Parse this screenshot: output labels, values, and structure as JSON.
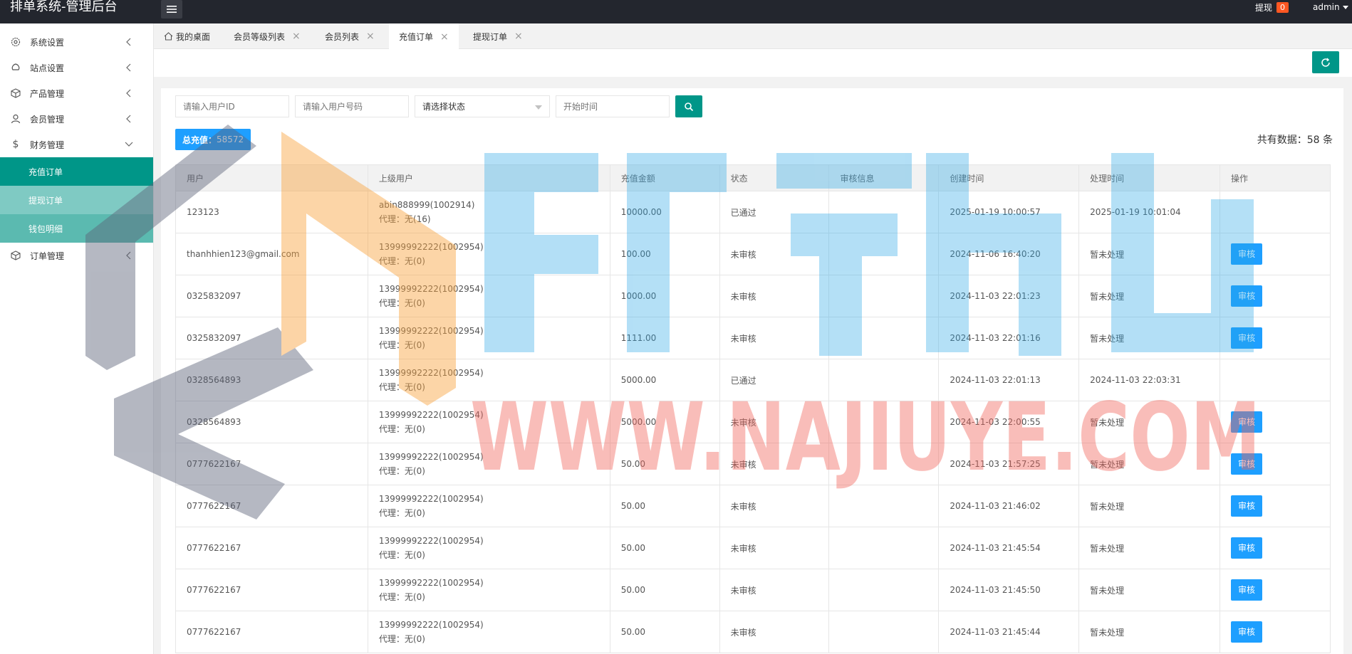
{
  "header": {
    "brand": "排单系统-管理后台",
    "withdraw_label": "提现",
    "withdraw_count": "0",
    "username": "admin"
  },
  "sidebar": {
    "items": [
      {
        "label": "系统设置",
        "icon": "gear-icon"
      },
      {
        "label": "站点设置",
        "icon": "site-icon"
      },
      {
        "label": "产品管理",
        "icon": "package-icon"
      },
      {
        "label": "会员管理",
        "icon": "user-icon"
      },
      {
        "label": "财务管理",
        "icon": "dollar-icon"
      }
    ],
    "sub_items": [
      "充值订单",
      "提现订单",
      "钱包明细"
    ],
    "after": {
      "label": "订单管理",
      "icon": "package-icon"
    }
  },
  "tabs": [
    {
      "label": "我的桌面"
    },
    {
      "label": "会员等级列表"
    },
    {
      "label": "会员列表"
    },
    {
      "label": "充值订单"
    },
    {
      "label": "提现订单"
    }
  ],
  "filters": {
    "user_id_placeholder": "请输入用户ID",
    "user_phone_placeholder": "请输入用户号码",
    "status_select": "请选择状态",
    "start_time_placeholder": "开始时间"
  },
  "summary": {
    "total_label": "总充值：",
    "total_value": "58572",
    "record_count": "共有数据：58 条"
  },
  "table": {
    "headers": [
      "用户",
      "上级用户",
      "充值金额",
      "状态",
      "审核信息",
      "创建时间",
      "处理时间",
      "操作"
    ],
    "audit_label": "审核",
    "rows": [
      {
        "user": "123123",
        "parent": "abin888999(1002914)",
        "agent": "代理：无(16)",
        "amount": "10000.00",
        "status": "已通过",
        "info": "",
        "created": "2025-01-19 10:00:57",
        "processed": "2025-01-19 10:01:04",
        "action": ""
      },
      {
        "user": "thanhhien123@gmail.com",
        "parent": "13999992222(1002954)",
        "agent": "代理：无(0)",
        "amount": "100.00",
        "status": "未审核",
        "info": "",
        "created": "2024-11-06 16:40:20",
        "processed": "暂未处理",
        "action": "审核"
      },
      {
        "user": "0325832097",
        "parent": "13999992222(1002954)",
        "agent": "代理：无(0)",
        "amount": "1000.00",
        "status": "未审核",
        "info": "",
        "created": "2024-11-03 22:01:23",
        "processed": "暂未处理",
        "action": "审核"
      },
      {
        "user": "0325832097",
        "parent": "13999992222(1002954)",
        "agent": "代理：无(0)",
        "amount": "1111.00",
        "status": "未审核",
        "info": "",
        "created": "2024-11-03 22:01:16",
        "processed": "暂未处理",
        "action": "审核"
      },
      {
        "user": "0328564893",
        "parent": "13999992222(1002954)",
        "agent": "代理：无(0)",
        "amount": "5000.00",
        "status": "已通过",
        "info": "",
        "created": "2024-11-03 22:01:13",
        "processed": "2024-11-03 22:03:31",
        "action": ""
      },
      {
        "user": "0328564893",
        "parent": "13999992222(1002954)",
        "agent": "代理：无(0)",
        "amount": "5000.00",
        "status": "未审核",
        "info": "",
        "created": "2024-11-03 22:00:55",
        "processed": "暂未处理",
        "action": "审核"
      },
      {
        "user": "0777622167",
        "parent": "13999992222(1002954)",
        "agent": "代理：无(0)",
        "amount": "50.00",
        "status": "未审核",
        "info": "",
        "created": "2024-11-03 21:57:25",
        "processed": "暂未处理",
        "action": "审核"
      },
      {
        "user": "0777622167",
        "parent": "13999992222(1002954)",
        "agent": "代理：无(0)",
        "amount": "50.00",
        "status": "未审核",
        "info": "",
        "created": "2024-11-03 21:46:02",
        "processed": "暂未处理",
        "action": "审核"
      },
      {
        "user": "0777622167",
        "parent": "13999992222(1002954)",
        "agent": "代理：无(0)",
        "amount": "50.00",
        "status": "未审核",
        "info": "",
        "created": "2024-11-03 21:45:54",
        "processed": "暂未处理",
        "action": "审核"
      },
      {
        "user": "0777622167",
        "parent": "13999992222(1002954)",
        "agent": "代理：无(0)",
        "amount": "50.00",
        "status": "未审核",
        "info": "",
        "created": "2024-11-03 21:45:50",
        "processed": "暂未处理",
        "action": "审核"
      },
      {
        "user": "0777622167",
        "parent": "13999992222(1002954)",
        "agent": "代理：无(0)",
        "amount": "50.00",
        "status": "未审核",
        "info": "",
        "created": "2024-11-03 21:45:44",
        "processed": "暂未处理",
        "action": "审核"
      }
    ]
  },
  "watermark": {
    "domain": "WWW.NAJIUYE.COM"
  },
  "colors": {
    "primary": "#009688",
    "accent": "#1e9fff",
    "header": "#23262e",
    "badge": "#ff5722"
  }
}
